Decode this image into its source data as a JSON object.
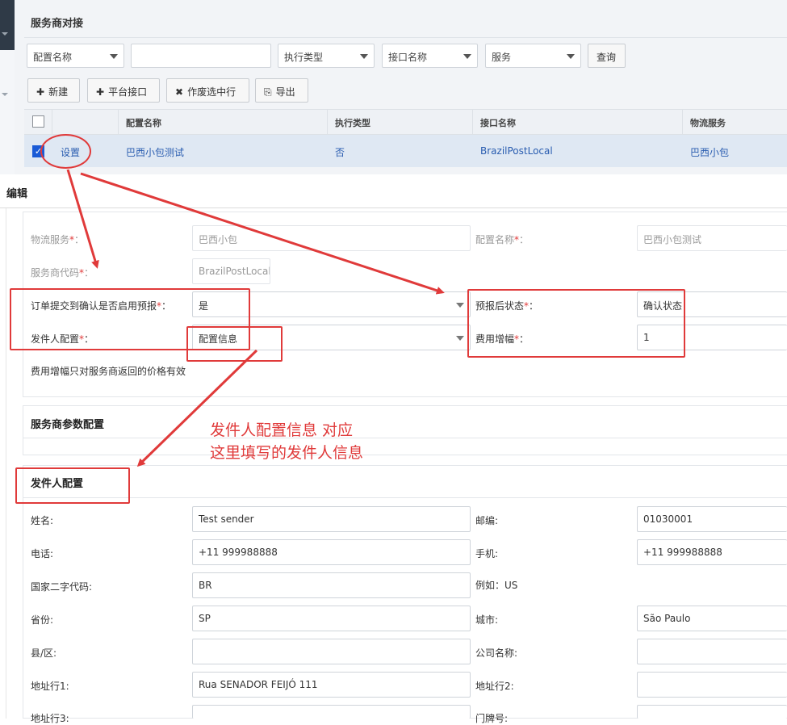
{
  "page": {
    "title": "服务商对接"
  },
  "filters": {
    "config_name_select": "配置名称",
    "config_name_input": "",
    "exec_type_select": "执行类型",
    "interface_select": "接口名称",
    "service_select": "服务",
    "query_button": "查询"
  },
  "toolbar": {
    "new": "新建",
    "platform_interface": "平台接口",
    "void_selected": "作废选中行",
    "export": "导出"
  },
  "grid": {
    "columns": [
      "配置名称",
      "执行类型",
      "接口名称",
      "物流服务"
    ],
    "rows": [
      {
        "action": "设置",
        "config_name": "巴西小包测试",
        "exec_type": "否",
        "interface": "BrazilPostLocal",
        "service": "巴西小包"
      }
    ]
  },
  "dialog": {
    "title": "编辑",
    "logistics_service_label": "物流服务",
    "logistics_service_value": "巴西小包",
    "config_name_label": "配置名称",
    "config_name_value": "巴西小包测试",
    "provider_code_label": "服务商代码",
    "provider_code_value": "BrazilPostLocal",
    "prereport_label": "订单提交到确认是否启用预报",
    "prereport_value": "是",
    "after_status_label": "预报后状态",
    "after_status_value": "确认状态",
    "sender_config_label": "发件人配置",
    "sender_config_value": "配置信息",
    "fee_increase_label": "费用增幅",
    "fee_increase_value": "1",
    "fee_note": "费用增幅只对服务商返回的价格有效",
    "provider_params_title": "服务商参数配置",
    "sender_section_title": "发件人配置",
    "required_mark": "*",
    "colon": "："
  },
  "sender": {
    "name_label": "姓名:",
    "name_value": "Test sender",
    "zip_label": "邮编:",
    "zip_value": "01030001",
    "phone_label": "电话:",
    "phone_value": "+11 999988888",
    "mobile_label": "手机:",
    "mobile_value": "+11 999988888",
    "country_label": "国家二字代码:",
    "country_value": "BR",
    "example_text": "例如：US",
    "province_label": "省份:",
    "province_value": "SP",
    "city_label": "城市:",
    "city_value": "São Paulo",
    "county_label": "县/区:",
    "county_value": "",
    "company_label": "公司名称:",
    "company_value": "",
    "addr1_label": "地址行1:",
    "addr1_value": "Rua SENADOR FEIJÓ 111",
    "addr2_label": "地址行2:",
    "addr2_value": "",
    "addr3_label": "地址行3:",
    "addr3_value": "",
    "doorplate_label": "门牌号:",
    "doorplate_value": ""
  },
  "annotation": {
    "line1": "发件人配置信息  对应",
    "line2": "这里填写的发件人信息",
    "color": "#e03a3a"
  }
}
